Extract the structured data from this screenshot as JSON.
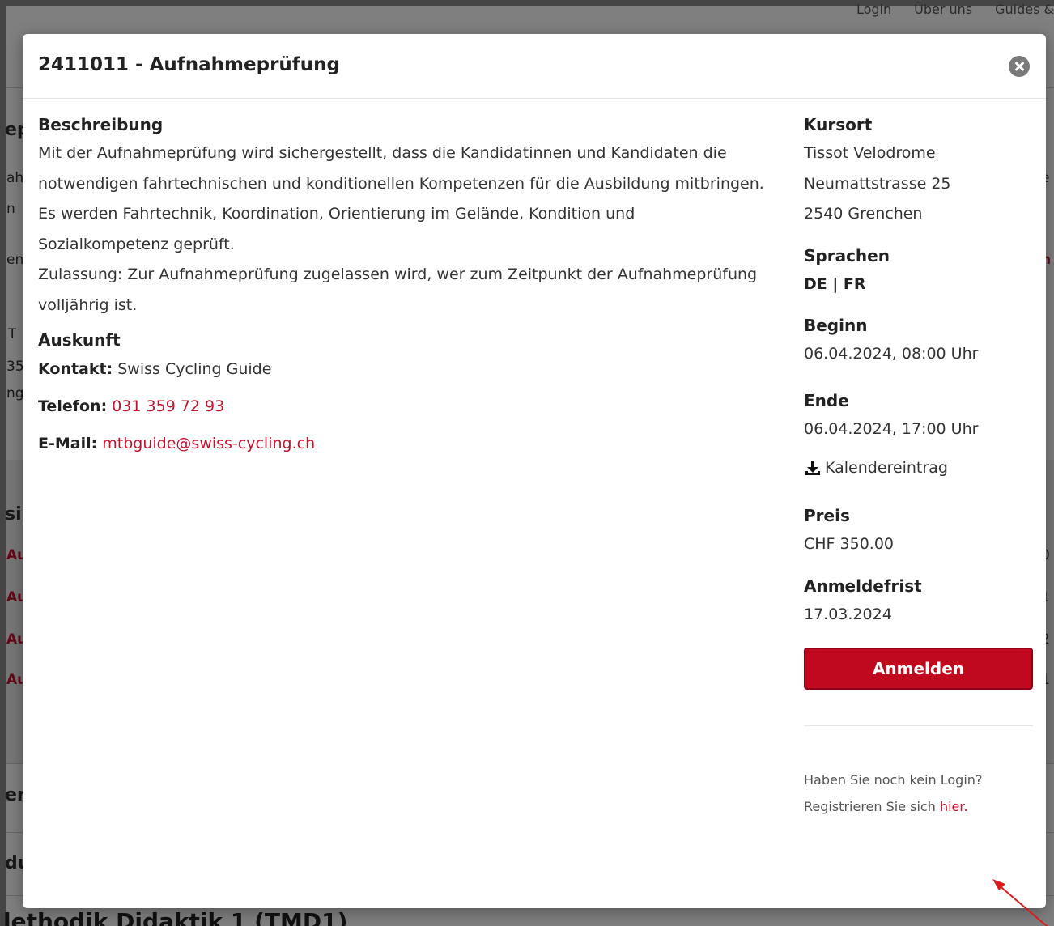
{
  "background": {
    "nav": [
      "Login",
      "Über uns",
      "Guides &"
    ],
    "left_fragments": [
      "ep",
      "ah",
      "n",
      "en",
      "T",
      "35",
      "ng",
      "si",
      "Au",
      "Au",
      "Au",
      "Au",
      "er",
      "du"
    ],
    "right_fragments": [
      "e",
      "n",
      "0",
      "1",
      "2",
      "1"
    ],
    "footer_title": "lethodik Didaktik 1 (TMD1)"
  },
  "modal": {
    "title": "2411011 - Aufnahmeprüfung",
    "description": {
      "heading": "Beschreibung",
      "text1": "Mit der Aufnahmeprüfung wird sichergestellt, dass die Kandidatinnen und Kandidaten die notwendigen fahrtechnischen und konditionellen Kompetenzen für die Ausbildung mitbringen. Es werden Fahrtechnik, Koordination, Orientierung im Gelände, Kondition und Sozialkompetenz geprüft.",
      "text2": "Zulassung: Zur Aufnahmeprüfung zugelassen wird, wer zum Zeitpunkt der Aufnahmeprüfung volljährig ist."
    },
    "contact": {
      "heading": "Auskunft",
      "kontakt_label": "Kontakt:",
      "kontakt_value": "Swiss Cycling Guide",
      "telefon_label": "Telefon:",
      "telefon_value": "031 359 72 93",
      "email_label": "E-Mail:",
      "email_value": "mtbguide@swiss-cycling.ch"
    },
    "details": {
      "kursort_label": "Kursort",
      "kursort_line1": "Tissot Velodrome",
      "kursort_line2": "Neumattstrasse 25",
      "kursort_line3": "2540 Grenchen",
      "sprachen_label": "Sprachen",
      "sprachen_value": "DE | FR",
      "beginn_label": "Beginn",
      "beginn_value": "06.04.2024, 08:00 Uhr",
      "ende_label": "Ende",
      "ende_value": "06.04.2024, 17:00 Uhr",
      "kalender_label": "Kalendereintrag",
      "preis_label": "Preis",
      "preis_value": "CHF 350.00",
      "anmeldefrist_label": "Anmeldefrist",
      "anmeldefrist_value": "17.03.2024",
      "anmelden_button": "Anmelden",
      "no_login_text": "Haben Sie noch kein Login?",
      "register_text": "Registrieren Sie sich ",
      "register_link": "hier."
    }
  },
  "colors": {
    "brand_red": "#c0081e",
    "link_red": "#c8102e",
    "annotation_arrow": "#d91c1c"
  }
}
